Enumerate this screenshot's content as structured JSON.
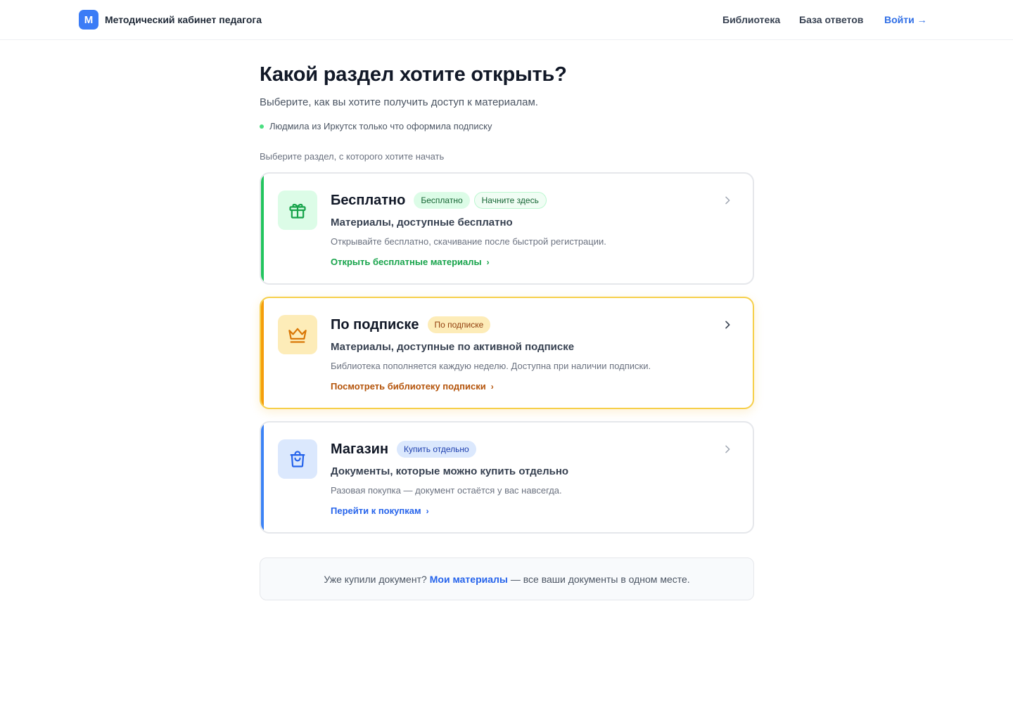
{
  "header": {
    "logo_letter": "М",
    "title": "Методический кабинет педагога",
    "nav": {
      "library": "Библиотека",
      "answers": "База ответов",
      "login": "Войти →"
    }
  },
  "main": {
    "title": "Какой раздел хотите открыть?",
    "subtitle": "Выберите, как вы хотите получить доступ к материалам.",
    "activity": "Людмила из Иркутск только что оформила подписку",
    "section_hint": "Выберите раздел, с которого хотите начать"
  },
  "cards": [
    {
      "title": "Бесплатно",
      "badges": [
        "Бесплатно",
        "Начните здесь"
      ],
      "description": "Материалы, доступные бесплатно",
      "note": "Открывайте бесплатно, скачивание после быстрой регистрации.",
      "link": "Открыть бесплатные материалы",
      "icon": "gift-icon",
      "accent": "#22c55e"
    },
    {
      "title": "По подписке",
      "badges": [
        "По подписке"
      ],
      "description": "Материалы, доступные по активной подписке",
      "note": "Библиотека пополняется каждую неделю. Доступна при наличии подписки.",
      "link": "Посмотреть библиотеку подписки",
      "icon": "crown-icon",
      "accent": "#f59e0b"
    },
    {
      "title": "Магазин",
      "badges": [
        "Купить отдельно"
      ],
      "description": "Документы, которые можно купить отдельно",
      "note": "Разовая покупка — документ остаётся у вас навсегда.",
      "link": "Перейти к покупкам",
      "icon": "shopping-bag-icon",
      "accent": "#3b82f6"
    }
  ],
  "footer_note": {
    "before": "Уже купили документ?",
    "link": "Мои материалы",
    "after": "— все ваши документы в одном месте."
  }
}
